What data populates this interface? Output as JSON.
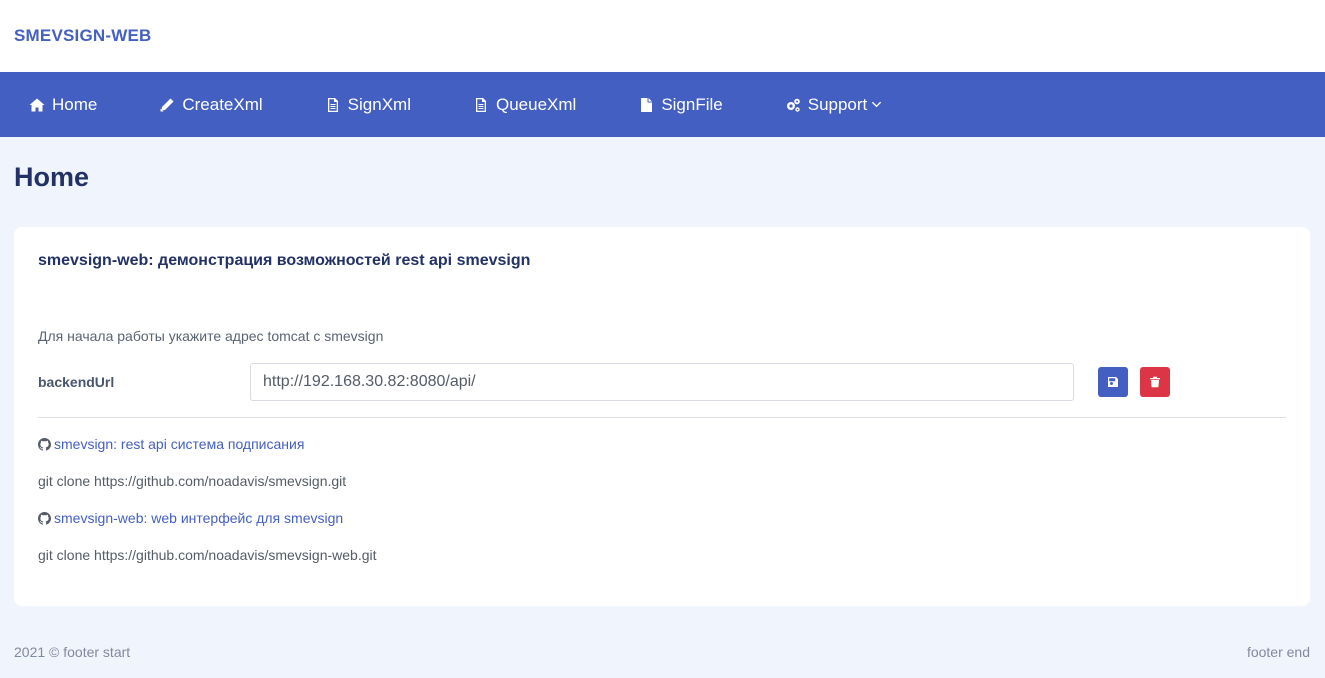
{
  "brand": "SMEVSIGN-WEB",
  "nav": {
    "items": [
      {
        "label": "Home",
        "icon": "home-icon"
      },
      {
        "label": "CreateXml",
        "icon": "pencil-icon"
      },
      {
        "label": "SignXml",
        "icon": "file-text-icon"
      },
      {
        "label": "QueueXml",
        "icon": "file-text-icon"
      },
      {
        "label": "SignFile",
        "icon": "file-icon"
      },
      {
        "label": "Support",
        "icon": "gears-icon"
      }
    ]
  },
  "page": {
    "title": "Home"
  },
  "card": {
    "title": "smevsign-web: демонстрация возможностей rest api smevsign",
    "hint": "Для начала работы укажите адрес tomcat c smevsign",
    "backend_label": "backendUrl",
    "backend_value": "http://192.168.30.82:8080/api/",
    "links": [
      {
        "label": "smevsign: rest api система подписания",
        "icon": "github-icon",
        "clone": "git clone https://github.com/noadavis/smevsign.git"
      },
      {
        "label": "smevsign-web: web интерфейс для smevsign",
        "icon": "github-icon",
        "clone": "git clone https://github.com/noadavis/smevsign-web.git"
      }
    ]
  },
  "footer": {
    "start": "2021 © footer start",
    "end": "footer end"
  },
  "colors": {
    "accent": "#445fc2",
    "danger": "#dc3545",
    "background": "#f0f5fd",
    "title": "#223266"
  }
}
